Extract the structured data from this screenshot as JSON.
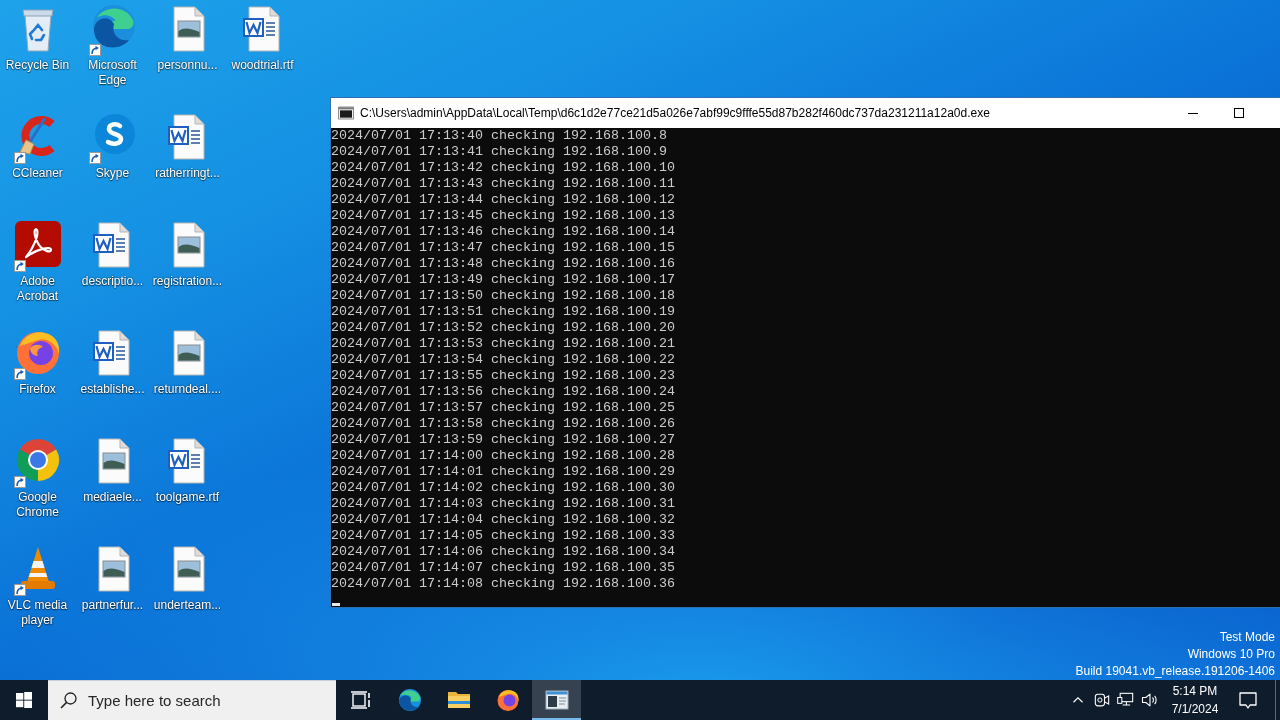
{
  "desktop": {
    "icons": [
      {
        "label": "Recycle Bin",
        "kind": "recycle-bin",
        "shortcut": false
      },
      {
        "label": "CCleaner",
        "kind": "ccleaner",
        "shortcut": true
      },
      {
        "label": "Adobe Acrobat",
        "kind": "acrobat",
        "shortcut": true
      },
      {
        "label": "Firefox",
        "kind": "firefox",
        "shortcut": true
      },
      {
        "label": "Google Chrome",
        "kind": "chrome",
        "shortcut": true
      },
      {
        "label": "VLC media player",
        "kind": "vlc",
        "shortcut": true
      },
      {
        "label": "Microsoft Edge",
        "kind": "edge",
        "shortcut": true
      },
      {
        "label": "Skype",
        "kind": "skype",
        "shortcut": true
      },
      {
        "label": "descriptio...",
        "kind": "word-doc",
        "shortcut": false
      },
      {
        "label": "establishe...",
        "kind": "word-doc",
        "shortcut": false
      },
      {
        "label": "mediaele...",
        "kind": "image-file",
        "shortcut": false
      },
      {
        "label": "partnerfur...",
        "kind": "image-file",
        "shortcut": false
      },
      {
        "label": "personnu...",
        "kind": "image-file",
        "shortcut": false
      },
      {
        "label": "ratherringt...",
        "kind": "word-doc",
        "shortcut": false
      },
      {
        "label": "registration...",
        "kind": "image-file",
        "shortcut": false
      },
      {
        "label": "returndeal....",
        "kind": "image-file",
        "shortcut": false
      },
      {
        "label": "toolgame.rtf",
        "kind": "word-doc",
        "shortcut": false
      },
      {
        "label": "underteam...",
        "kind": "image-file",
        "shortcut": false
      },
      {
        "label": "woodtrial.rtf",
        "kind": "word-doc",
        "shortcut": false
      }
    ]
  },
  "console_window": {
    "title": "C:\\Users\\admin\\AppData\\Local\\Temp\\d6c1d2e77ce21d5a026e7abf99c9fffe55d87b282f460dc737da231211a12a0d.exe",
    "lines": [
      "2024/07/01 17:13:40 checking 192.168.100.8",
      "2024/07/01 17:13:41 checking 192.168.100.9",
      "2024/07/01 17:13:42 checking 192.168.100.10",
      "2024/07/01 17:13:43 checking 192.168.100.11",
      "2024/07/01 17:13:44 checking 192.168.100.12",
      "2024/07/01 17:13:45 checking 192.168.100.13",
      "2024/07/01 17:13:46 checking 192.168.100.14",
      "2024/07/01 17:13:47 checking 192.168.100.15",
      "2024/07/01 17:13:48 checking 192.168.100.16",
      "2024/07/01 17:13:49 checking 192.168.100.17",
      "2024/07/01 17:13:50 checking 192.168.100.18",
      "2024/07/01 17:13:51 checking 192.168.100.19",
      "2024/07/01 17:13:52 checking 192.168.100.20",
      "2024/07/01 17:13:53 checking 192.168.100.21",
      "2024/07/01 17:13:54 checking 192.168.100.22",
      "2024/07/01 17:13:55 checking 192.168.100.23",
      "2024/07/01 17:13:56 checking 192.168.100.24",
      "2024/07/01 17:13:57 checking 192.168.100.25",
      "2024/07/01 17:13:58 checking 192.168.100.26",
      "2024/07/01 17:13:59 checking 192.168.100.27",
      "2024/07/01 17:14:00 checking 192.168.100.28",
      "2024/07/01 17:14:01 checking 192.168.100.29",
      "2024/07/01 17:14:02 checking 192.168.100.30",
      "2024/07/01 17:14:03 checking 192.168.100.31",
      "2024/07/01 17:14:04 checking 192.168.100.32",
      "2024/07/01 17:14:05 checking 192.168.100.33",
      "2024/07/01 17:14:06 checking 192.168.100.34",
      "2024/07/01 17:14:07 checking 192.168.100.35",
      "2024/07/01 17:14:08 checking 192.168.100.36"
    ],
    "cursor_visible": true
  },
  "system_watermark": {
    "lines": [
      "Test Mode",
      "Windows 10 Pro",
      "Build 19041.vb_release.191206-1406"
    ]
  },
  "taskbar": {
    "search": {
      "placeholder": "Type here to search"
    },
    "apps": [
      {
        "kind": "task-view",
        "selected": false
      },
      {
        "kind": "edge",
        "selected": false
      },
      {
        "kind": "folder",
        "selected": false
      },
      {
        "kind": "firefox",
        "selected": false
      },
      {
        "kind": "console",
        "selected": true
      }
    ],
    "tray": {
      "icons": [
        {
          "kind": "chevron-up"
        },
        {
          "kind": "meet-now"
        },
        {
          "kind": "network"
        },
        {
          "kind": "volume"
        }
      ],
      "time": "5:14 PM",
      "date": "7/1/2024"
    }
  }
}
